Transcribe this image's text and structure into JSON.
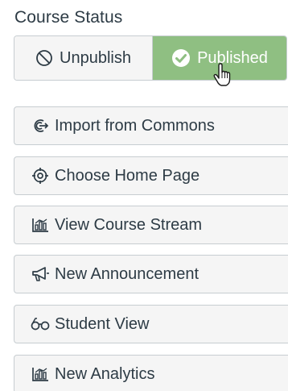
{
  "course_status": {
    "heading": "Course Status",
    "unpublish_label": "Unpublish",
    "published_label": "Published",
    "published_color": "#8fbf82"
  },
  "actions": [
    {
      "label": "Import from Commons",
      "icon": "import-commons-icon"
    },
    {
      "label": "Choose Home Page",
      "icon": "target-icon"
    },
    {
      "label": "View Course Stream",
      "icon": "bar-chart-icon"
    },
    {
      "label": "New Announcement",
      "icon": "megaphone-icon"
    },
    {
      "label": "Student View",
      "icon": "glasses-icon"
    },
    {
      "label": "New Analytics",
      "icon": "analytics-icon"
    }
  ]
}
